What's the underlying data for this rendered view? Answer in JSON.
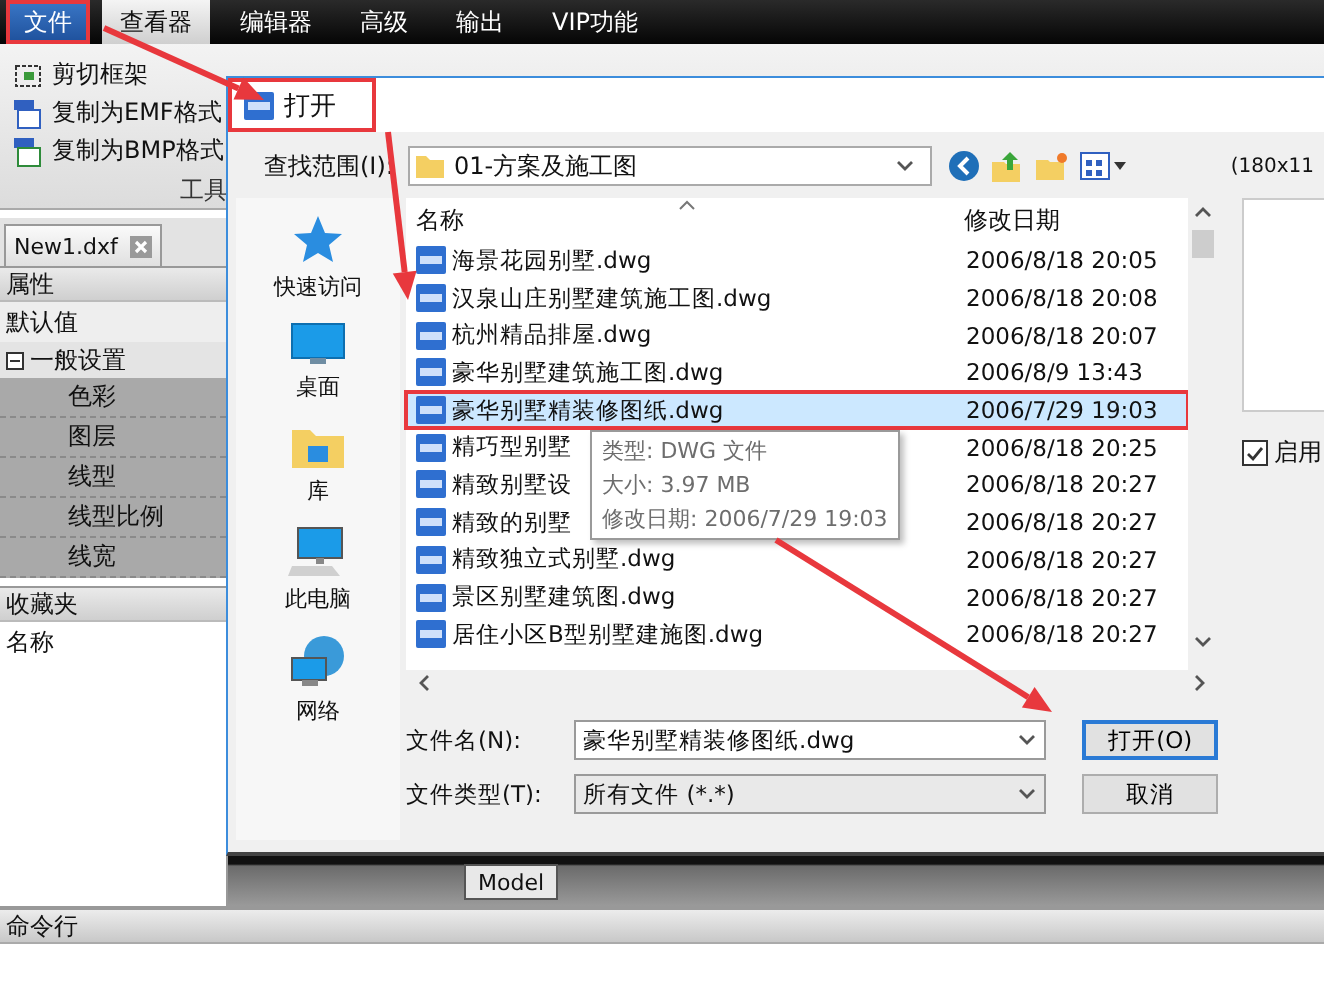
{
  "menu": [
    {
      "label": "文件",
      "kind": "app",
      "selected": false,
      "highlighted": true
    },
    {
      "label": "查看器",
      "kind": "tab",
      "selected": true,
      "highlighted": false
    },
    {
      "label": "编辑器",
      "kind": "tab",
      "selected": false,
      "highlighted": false
    },
    {
      "label": "高级",
      "kind": "tab",
      "selected": false,
      "highlighted": false
    },
    {
      "label": "输出",
      "kind": "tab",
      "selected": false,
      "highlighted": false
    },
    {
      "label": "VIP功能",
      "kind": "tab",
      "selected": false,
      "highlighted": false
    }
  ],
  "ribbon": {
    "items": [
      {
        "label": "剪切框架",
        "kind": "frame"
      },
      {
        "label": "复制为EMF格式",
        "kind": "emf"
      },
      {
        "label": "复制为BMP格式",
        "kind": "bmp"
      }
    ],
    "group_label": "工具"
  },
  "document_tab": {
    "label": "New1.dxf"
  },
  "properties": {
    "title": "属性",
    "default_label": "默认值",
    "group": {
      "label": "一般设置",
      "expanded": true,
      "children": [
        "色彩",
        "图层",
        "线型",
        "线型比例",
        "线宽"
      ]
    }
  },
  "favorites": {
    "title": "收藏夹",
    "column": "名称"
  },
  "canvas_tab": {
    "label": "Model"
  },
  "command_line": {
    "title": "命令行"
  },
  "dialog": {
    "title": "打开",
    "title_highlighted": true,
    "look_in_label": "查找范围(I):",
    "look_in_value": "01-方案及施工图",
    "preview_size": "(180x11",
    "places": [
      {
        "label": "快速访问",
        "kind": "star"
      },
      {
        "label": "桌面",
        "kind": "desktop"
      },
      {
        "label": "库",
        "kind": "library"
      },
      {
        "label": "此电脑",
        "kind": "computer"
      },
      {
        "label": "网络",
        "kind": "network"
      }
    ],
    "columns": [
      "名称",
      "修改日期"
    ],
    "files": [
      {
        "name": "海景花园别墅.dwg",
        "date": "2006/8/18 20:05",
        "selected": false,
        "highlighted": false
      },
      {
        "name": "汉泉山庄别墅建筑施工图.dwg",
        "date": "2006/8/18 20:08",
        "selected": false,
        "highlighted": false
      },
      {
        "name": "杭州精品排屋.dwg",
        "date": "2006/8/18 20:07",
        "selected": false,
        "highlighted": false
      },
      {
        "name": "豪华别墅建筑施工图.dwg",
        "date": "2006/8/9 13:43",
        "selected": false,
        "highlighted": false
      },
      {
        "name": "豪华别墅精装修图纸.dwg",
        "date": "2006/7/29 19:03",
        "selected": true,
        "highlighted": true
      },
      {
        "name": "精巧型别墅",
        "date": "2006/8/18 20:25",
        "selected": false,
        "highlighted": false
      },
      {
        "name": "精致别墅设",
        "date": "2006/8/18 20:27",
        "selected": false,
        "highlighted": false
      },
      {
        "name": "精致的别墅",
        "date": "2006/8/18 20:27",
        "selected": false,
        "highlighted": false
      },
      {
        "name": "精致独立式别墅.dwg",
        "date": "2006/8/18 20:27",
        "selected": false,
        "highlighted": false
      },
      {
        "name": "景区别墅建筑图.dwg",
        "date": "2006/8/18 20:27",
        "selected": false,
        "highlighted": false
      },
      {
        "name": "居住小区B型别墅建施图.dwg",
        "date": "2006/8/18 20:27",
        "selected": false,
        "highlighted": false
      }
    ],
    "tooltip": {
      "lines": [
        "类型: DWG 文件",
        "大小: 3.97 MB",
        "修改日期: 2006/7/29 19:03"
      ]
    },
    "filename_label": "文件名(N):",
    "filename_value": "豪华别墅精装修图纸.dwg",
    "filetype_label": "文件类型(T):",
    "filetype_value": "所有文件 (*.*)",
    "buttons": [
      {
        "label": "打开(O)",
        "kind": "primary"
      },
      {
        "label": "取消",
        "kind": "normal"
      }
    ],
    "preview_checkbox": {
      "label": "启用",
      "checked": true
    }
  }
}
